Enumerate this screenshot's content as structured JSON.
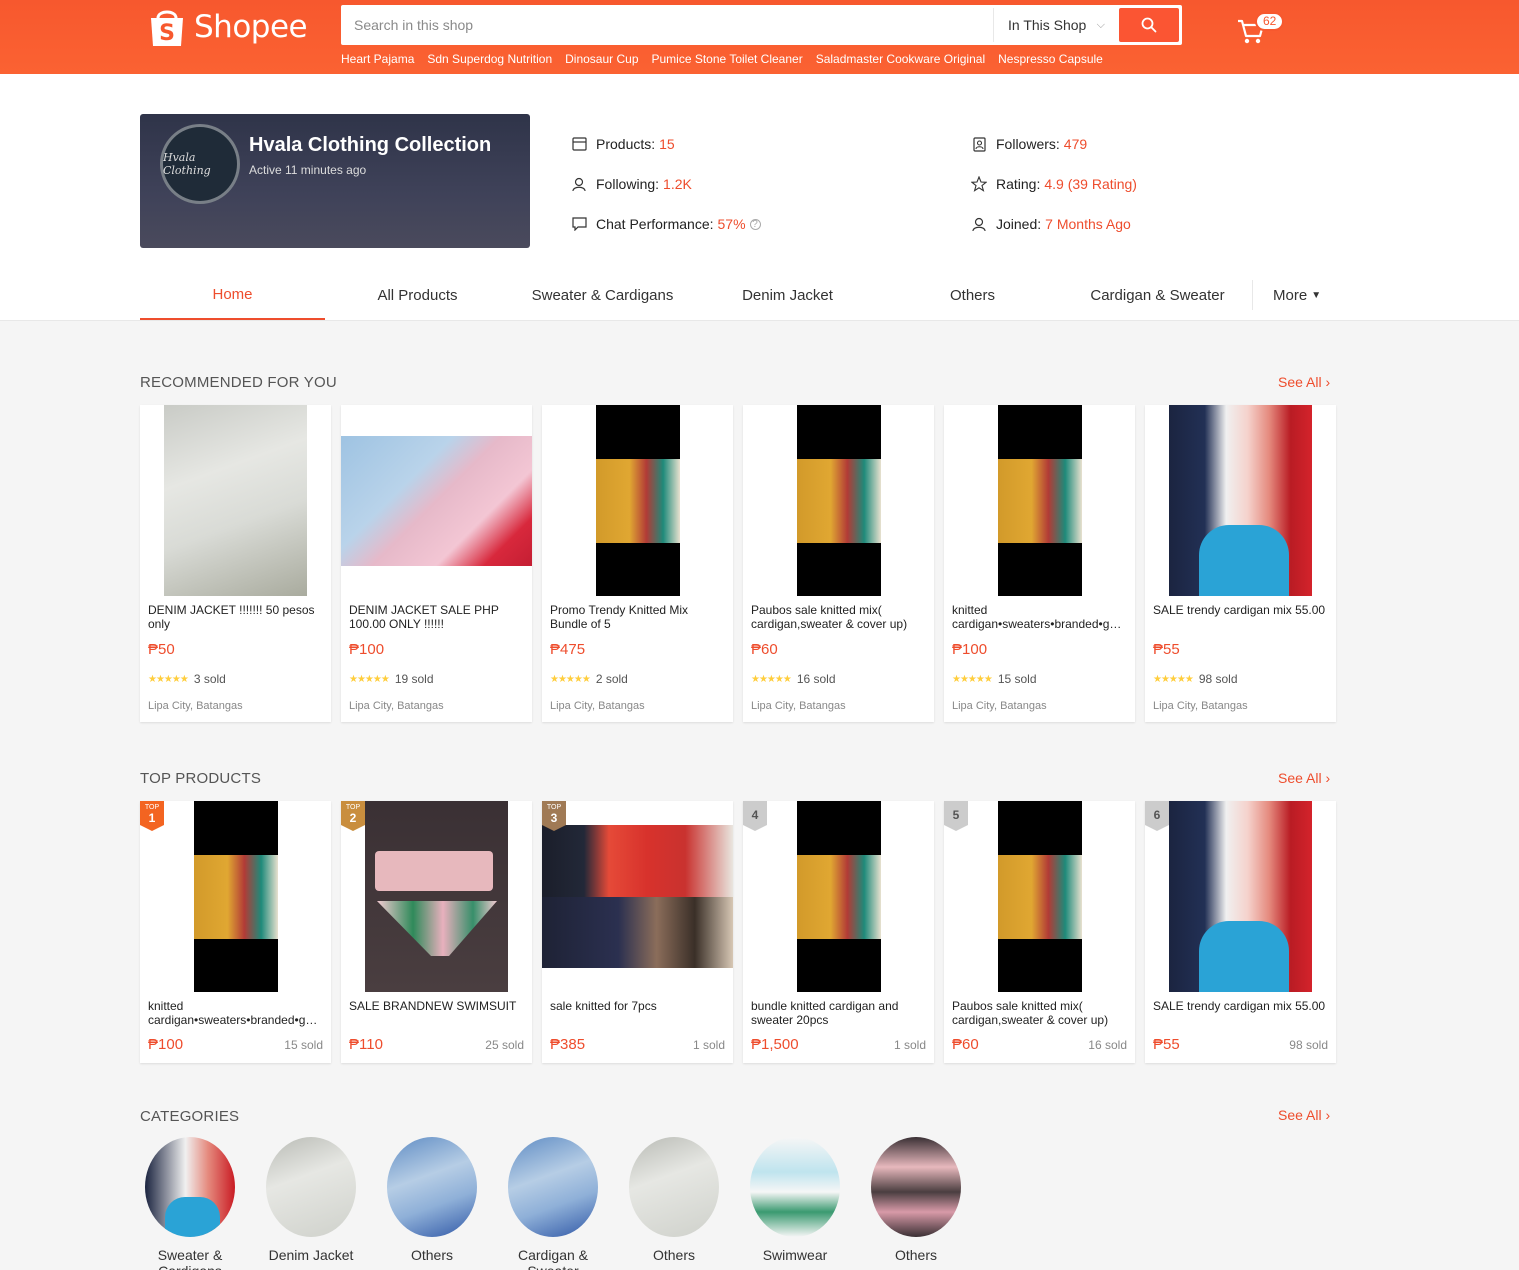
{
  "header": {
    "logo_text": "Shopee",
    "search_placeholder": "Search in this shop",
    "scope_label": "In This Shop",
    "cart_count": "62",
    "keywords": [
      "Heart Pajama",
      "Sdn Superdog Nutrition",
      "Dinosaur Cup",
      "Pumice Stone Toilet Cleaner",
      "Saladmaster Cookware Original",
      "Nespresso Capsule"
    ]
  },
  "shop": {
    "name": "Hvala Clothing Collection",
    "active": "Active 11 minutes ago",
    "avatar_text": "Hvala Clothing",
    "stats": {
      "products_label": "Products:",
      "products_value": "15",
      "following_label": "Following:",
      "following_value": "1.2K",
      "chat_label": "Chat Performance:",
      "chat_value": "57%",
      "followers_label": "Followers:",
      "followers_value": "479",
      "rating_label": "Rating:",
      "rating_value": "4.9 (39 Rating)",
      "joined_label": "Joined:",
      "joined_value": "7 Months Ago"
    }
  },
  "tabs": {
    "items": [
      "Home",
      "All Products",
      "Sweater & Cardigans",
      "Denim Jacket",
      "Others",
      "Cardigan & Sweater"
    ],
    "more": "More"
  },
  "recommended": {
    "title": "RECOMMENDED FOR YOU",
    "see_all": "See All",
    "items": [
      {
        "name": "DENIM JACKET !!!!!!! 50 pesos only",
        "price": "₱50",
        "sold": "3 sold",
        "location": "Lipa City, Batangas"
      },
      {
        "name": "DENIM JACKET SALE PHP 100.00 ONLY !!!!!!",
        "price": "₱100",
        "sold": "19 sold",
        "location": "Lipa City, Batangas"
      },
      {
        "name": "Promo Trendy Knitted Mix Bundle of 5",
        "price": "₱475",
        "sold": "2 sold",
        "location": "Lipa City, Batangas"
      },
      {
        "name": "Paubos sale knitted mix( cardigan,sweater & cover up)",
        "price": "₱60",
        "sold": "16 sold",
        "location": "Lipa City, Batangas"
      },
      {
        "name": "knitted cardigan•sweaters•branded•good quality",
        "price": "₱100",
        "sold": "15 sold",
        "location": "Lipa City, Batangas"
      },
      {
        "name": "SALE trendy cardigan mix 55.00",
        "price": "₱55",
        "sold": "98 sold",
        "location": "Lipa City, Batangas"
      }
    ]
  },
  "top_products": {
    "title": "TOP PRODUCTS",
    "see_all": "See All",
    "top_label": "TOP",
    "items": [
      {
        "rank": "1",
        "name": "knitted cardigan•sweaters•branded•good quality",
        "price": "₱100",
        "sold": "15 sold"
      },
      {
        "rank": "2",
        "name": "SALE BRANDNEW SWIMSUIT",
        "price": "₱110",
        "sold": "25 sold"
      },
      {
        "rank": "3",
        "name": "sale knitted for 7pcs",
        "price": "₱385",
        "sold": "1 sold"
      },
      {
        "rank": "4",
        "name": "bundle knitted cardigan and sweater 20pcs",
        "price": "₱1,500",
        "sold": "1 sold"
      },
      {
        "rank": "5",
        "name": "Paubos sale knitted mix( cardigan,sweater & cover up)",
        "price": "₱60",
        "sold": "16 sold"
      },
      {
        "rank": "6",
        "name": "SALE trendy cardigan mix 55.00",
        "price": "₱55",
        "sold": "98 sold"
      }
    ]
  },
  "categories": {
    "title": "CATEGORIES",
    "see_all": "See All",
    "items": [
      "Sweater & Cardigans",
      "Denim Jacket",
      "Others",
      "Cardigan & Sweater",
      "Others",
      "Swimwear",
      "Others"
    ]
  },
  "colors": {
    "brand": "#f7582e",
    "accent": "#ee4d2d",
    "star": "#ffce3d"
  }
}
